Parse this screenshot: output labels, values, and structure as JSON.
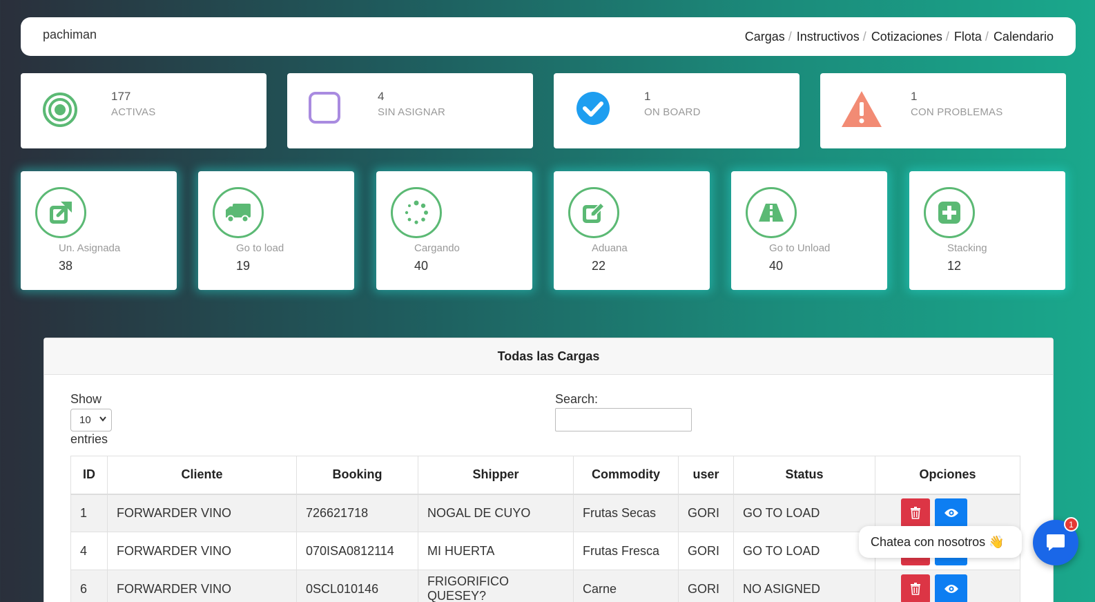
{
  "navbar": {
    "brand": "pachiman",
    "links": [
      "Cargas",
      "Instructivos",
      "Cotizaciones",
      "Flota",
      "Calendario"
    ]
  },
  "stats": [
    {
      "value": "177",
      "label": "ACTIVAS",
      "icon": "target-icon",
      "color": "#5bb974"
    },
    {
      "value": "4",
      "label": "SIN ASIGNAR",
      "icon": "square-icon",
      "color": "#a98be0"
    },
    {
      "value": "1",
      "label": "ON BOARD",
      "icon": "check-circle-icon",
      "color": "#1e9ef0"
    },
    {
      "value": "1",
      "label": "CON PROBLEMAS",
      "icon": "warning-icon",
      "color": "#f28b74"
    }
  ],
  "process": [
    {
      "label": "Un. Asignada",
      "value": "38",
      "icon": "external-link-icon"
    },
    {
      "label": "Go to load",
      "value": "19",
      "icon": "truck-icon"
    },
    {
      "label": "Cargando",
      "value": "40",
      "icon": "spinner-icon"
    },
    {
      "label": "Aduana",
      "value": "22",
      "icon": "edit-icon"
    },
    {
      "label": "Go to Unload",
      "value": "40",
      "icon": "road-icon"
    },
    {
      "label": "Stacking",
      "value": "12",
      "icon": "plus-square-icon"
    }
  ],
  "panel": {
    "title": "Todas las Cargas",
    "show_label": "Show",
    "entries_value": "10",
    "entries_label": "entries",
    "search_label": "Search:",
    "columns": [
      "ID",
      "Cliente",
      "Booking",
      "Shipper",
      "Commodity",
      "user",
      "Status",
      "Opciones"
    ],
    "rows": [
      {
        "id": "1",
        "cliente": "FORWARDER VINO",
        "booking": "726621718",
        "shipper": "NOGAL DE CUYO",
        "commodity": "Frutas Secas",
        "user": "GORI",
        "status": "GO TO LOAD"
      },
      {
        "id": "4",
        "cliente": "FORWARDER VINO",
        "booking": "070ISA0812114",
        "shipper": "MI HUERTA",
        "commodity": "Frutas Fresca",
        "user": "GORI",
        "status": "GO TO LOAD"
      },
      {
        "id": "6",
        "cliente": "FORWARDER VINO",
        "booking": "0SCL010146",
        "shipper": "FRIGORIFICO QUESEY?",
        "commodity": "Carne",
        "user": "GORI",
        "status": "NO ASIGNED"
      }
    ]
  },
  "chat": {
    "text": "Chatea con nosotros 👋",
    "badge": "1"
  },
  "colors": {
    "accent_green": "#5bb974",
    "delete_red": "#dc3545",
    "view_blue": "#0d7ef2",
    "chat_blue": "#1a67e8"
  }
}
